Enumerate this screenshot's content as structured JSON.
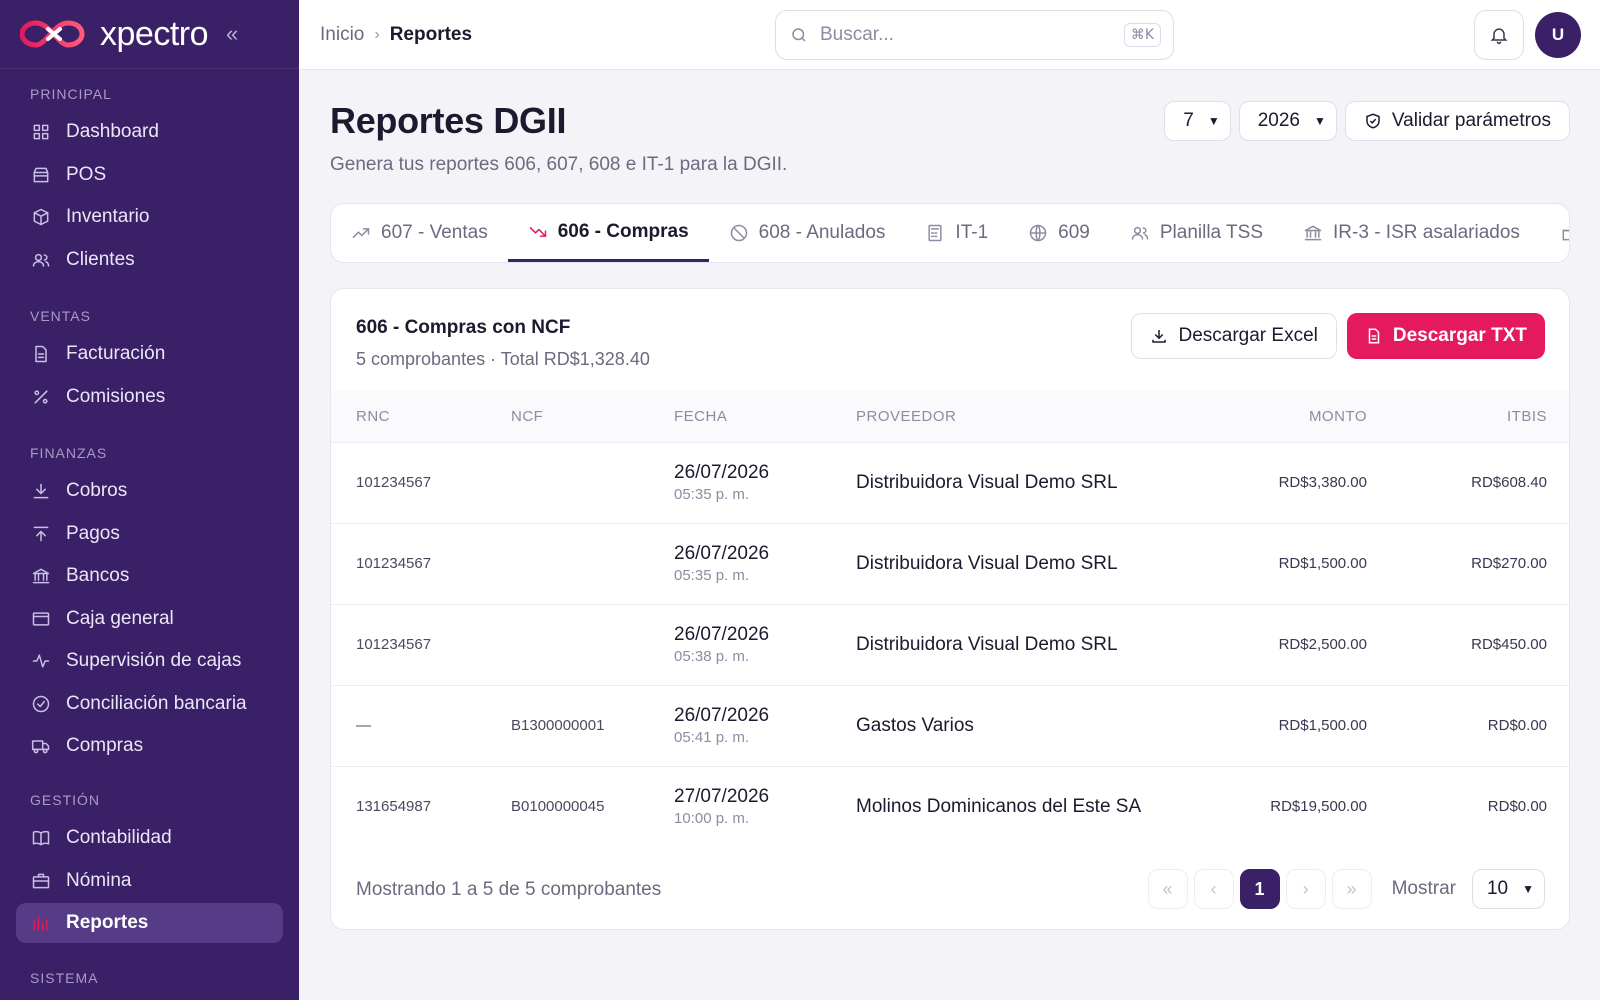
{
  "brand": {
    "name": "xpectro"
  },
  "sidebar": {
    "sections": [
      {
        "heading": "PRINCIPAL",
        "items": [
          {
            "label": "Dashboard",
            "icon": "grid-icon"
          },
          {
            "label": "POS",
            "icon": "store-icon"
          },
          {
            "label": "Inventario",
            "icon": "box-icon"
          },
          {
            "label": "Clientes",
            "icon": "users-icon"
          }
        ]
      },
      {
        "heading": "VENTAS",
        "items": [
          {
            "label": "Facturación",
            "icon": "document-icon"
          },
          {
            "label": "Comisiones",
            "icon": "percent-icon"
          }
        ]
      },
      {
        "heading": "FINANZAS",
        "items": [
          {
            "label": "Cobros",
            "icon": "download-icon"
          },
          {
            "label": "Pagos",
            "icon": "upload-icon"
          },
          {
            "label": "Bancos",
            "icon": "bank-icon"
          },
          {
            "label": "Caja general",
            "icon": "cash-box-icon"
          },
          {
            "label": "Supervisión de cajas",
            "icon": "activity-icon"
          },
          {
            "label": "Conciliación bancaria",
            "icon": "check-circle-icon"
          },
          {
            "label": "Compras",
            "icon": "truck-icon"
          }
        ]
      },
      {
        "heading": "GESTIÓN",
        "items": [
          {
            "label": "Contabilidad",
            "icon": "book-icon"
          },
          {
            "label": "Nómina",
            "icon": "briefcase-icon"
          },
          {
            "label": "Reportes",
            "icon": "chart-icon",
            "active": true
          }
        ]
      },
      {
        "heading": "SISTEMA",
        "items": []
      }
    ]
  },
  "topbar": {
    "breadcrumb": {
      "home": "Inicio",
      "current": "Reportes"
    },
    "search_placeholder": "Buscar...",
    "search_shortcut": "⌘K",
    "avatar_initial": "U"
  },
  "header": {
    "title": "Reportes DGII",
    "subtitle": "Genera tus reportes 606, 607, 608 e IT-1 para la DGII.",
    "month": "7",
    "year": "2026",
    "validate_label": "Validar parámetros"
  },
  "tabs": [
    {
      "label": "607 - Ventas",
      "icon": "trending-up-icon"
    },
    {
      "label": "606 - Compras",
      "icon": "trending-down-icon",
      "active": true
    },
    {
      "label": "608 - Anulados",
      "icon": "ban-icon"
    },
    {
      "label": "IT-1",
      "icon": "calculator-icon"
    },
    {
      "label": "609",
      "icon": "globe-icon"
    },
    {
      "label": "Planilla TSS",
      "icon": "users-icon"
    },
    {
      "label": "IR-3 - ISR asalariados",
      "icon": "bank-icon"
    }
  ],
  "card": {
    "title": "606 - Compras con NCF",
    "subtitle": "5 comprobantes · Total RD$1,328.40",
    "excel_label": "Descargar Excel",
    "txt_label": "Descargar TXT"
  },
  "table": {
    "headers": {
      "rnc": "RNC",
      "ncf": "NCF",
      "fecha": "FECHA",
      "proveedor": "PROVEEDOR",
      "monto": "MONTO",
      "itbis": "ITBIS"
    },
    "rows": [
      {
        "rnc": "101234567",
        "ncf": "",
        "date": "26/07/2026",
        "time": "05:35 p. m.",
        "proveedor": "Distribuidora Visual Demo SRL",
        "monto": "RD$3,380.00",
        "itbis": "RD$608.40"
      },
      {
        "rnc": "101234567",
        "ncf": "",
        "date": "26/07/2026",
        "time": "05:35 p. m.",
        "proveedor": "Distribuidora Visual Demo SRL",
        "monto": "RD$1,500.00",
        "itbis": "RD$270.00"
      },
      {
        "rnc": "101234567",
        "ncf": "",
        "date": "26/07/2026",
        "time": "05:38 p. m.",
        "proveedor": "Distribuidora Visual Demo SRL",
        "monto": "RD$2,500.00",
        "itbis": "RD$450.00"
      },
      {
        "rnc": "—",
        "ncf": "B1300000001",
        "date": "26/07/2026",
        "time": "05:41 p. m.",
        "proveedor": "Gastos Varios",
        "monto": "RD$1,500.00",
        "itbis": "RD$0.00"
      },
      {
        "rnc": "131654987",
        "ncf": "B0100000045",
        "date": "27/07/2026",
        "time": "10:00 p. m.",
        "proveedor": "Molinos Dominicanos del Este SA",
        "monto": "RD$19,500.00",
        "itbis": "RD$0.00"
      }
    ]
  },
  "pagination": {
    "summary": "Mostrando 1 a 5 de 5 comprobantes",
    "current_page": "1",
    "show_label": "Mostrar",
    "page_size": "10"
  },
  "colors": {
    "sidebar": "#3a2066",
    "accent": "#e5195e",
    "active_page": "#3a2066"
  }
}
